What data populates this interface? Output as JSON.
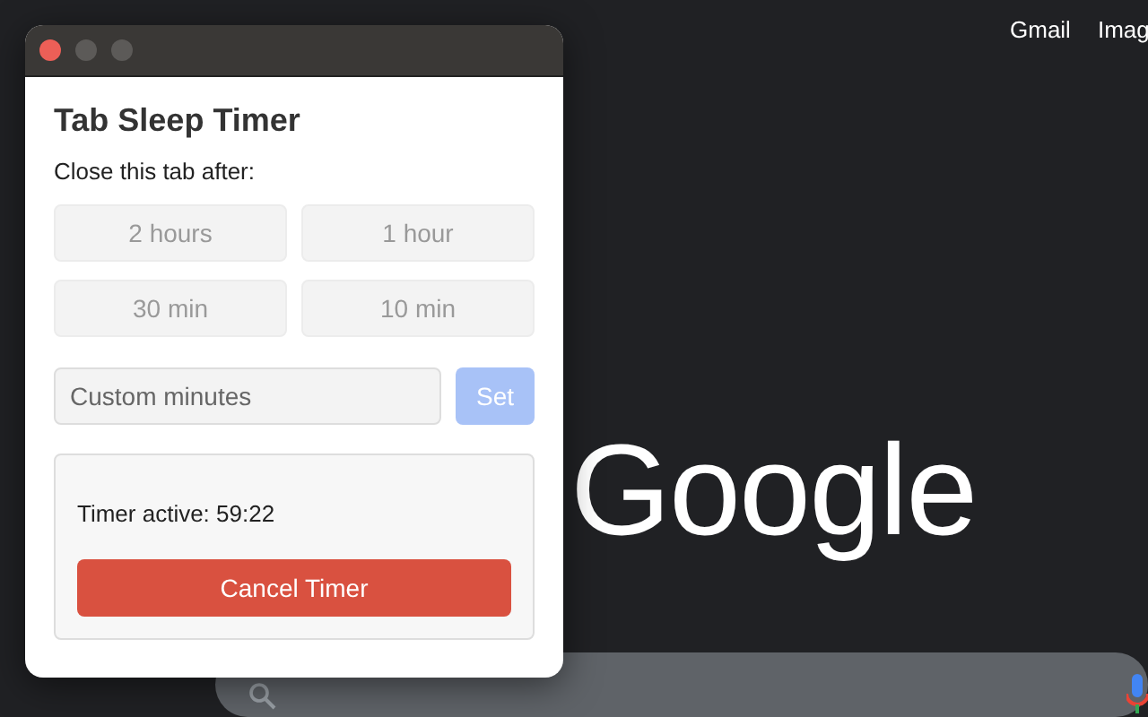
{
  "page": {
    "header_links": [
      "Gmail",
      "Imag"
    ],
    "logo": "Google"
  },
  "popup": {
    "title": "Tab Sleep Timer",
    "prompt": "Close this tab after:",
    "presets": [
      {
        "label": "2 hours",
        "disabled": true
      },
      {
        "label": "1 hour",
        "disabled": true
      },
      {
        "label": "30 min",
        "disabled": true
      },
      {
        "label": "10 min",
        "disabled": true
      }
    ],
    "custom": {
      "placeholder": "Custom minutes",
      "button": "Set",
      "disabled": true
    },
    "status": {
      "text": "Timer active: 59:22",
      "button": "Cancel Timer"
    }
  }
}
